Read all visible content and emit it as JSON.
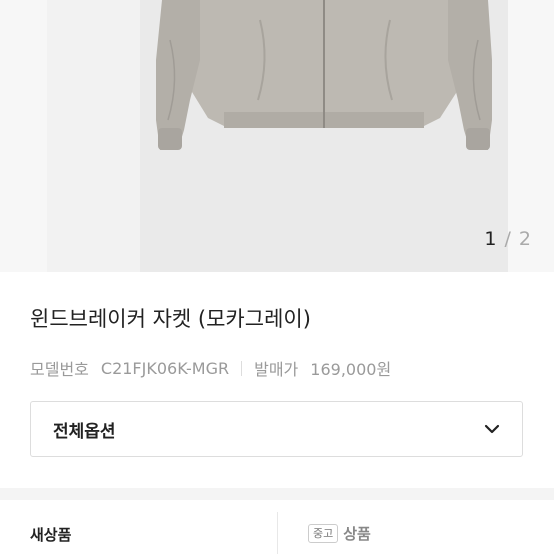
{
  "gallery": {
    "current": "1",
    "separator": " / ",
    "total": "2"
  },
  "product": {
    "title": "윈드브레이커 자켓 (모카그레이)",
    "model_label": "모델번호",
    "model_value": "C21FJK06K-MGR",
    "price_label": "발매가",
    "price_value": "169,000원"
  },
  "options": {
    "label": "전체옵션",
    "icon": "chevron-down-icon"
  },
  "tabs": {
    "new_label": "새상품",
    "used_badge": "중고",
    "used_label": "상품"
  },
  "colors": {
    "jacket": "#bcb8b1",
    "background": "#eaeaea"
  }
}
